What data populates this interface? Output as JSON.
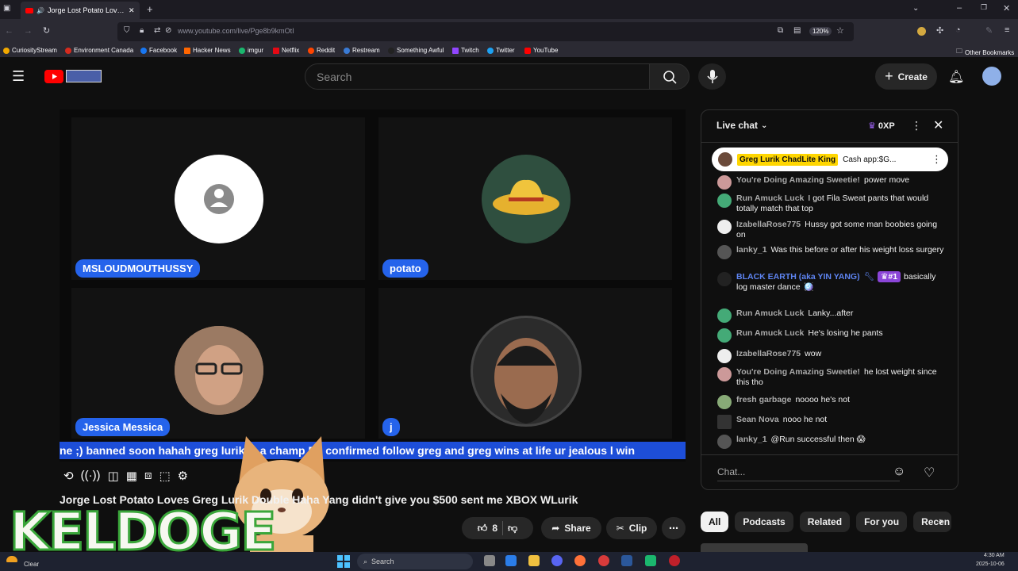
{
  "browser": {
    "tab_title": "Jorge Lost Potato Loves Gr...",
    "url": "www.youtube.com/live/Pge8b9kmOtI",
    "zoom": "120%",
    "bookmarks": [
      "CuriosityStream",
      "Environment Canada",
      "Facebook",
      "Hacker News",
      "imgur",
      "Netflix",
      "Reddit",
      "Restream",
      "Something Awful",
      "Twitch",
      "Twitter",
      "YouTube"
    ],
    "other_bookmarks": "Other Bookmarks"
  },
  "header": {
    "search_placeholder": "Search",
    "create_label": "Create"
  },
  "video": {
    "participants": [
      {
        "name": "MSLOUDMOUTHUSSY"
      },
      {
        "name": "potato"
      },
      {
        "name": "Jessica Messica"
      },
      {
        "name": "j"
      }
    ],
    "ticker": "ne ;) banned soon hahah greg lurik is a champ EZ confirmed follow greg and greg wins at life ur jealous l win",
    "title": "Jorge Lost Potato Loves Greg Lurik Double Haha Yang didn't give you $500 sent me XBOX WLurik",
    "likes": "8",
    "share_label": "Share",
    "clip_label": "Clip"
  },
  "chat": {
    "title": "Live chat",
    "xp": "0XP",
    "pinned_author": "Greg Lurik ChadLite King",
    "pinned_text": "Cash app:$G...",
    "messages": [
      {
        "author": "You're Doing Amazing Sweetie!",
        "text": "power move"
      },
      {
        "author": "Run Amuck Luck",
        "text": "I got Fila Sweat pants that would totally match that top"
      },
      {
        "author": "IzabellaRose775",
        "text": "Hussy got some man boobies going on"
      },
      {
        "author": "lanky_1",
        "text": "Was this before or after his weight loss surgery"
      },
      {
        "author": "BLACK EARTH (aka YIN YANG)",
        "badge": "#1",
        "text": "basically log master dance",
        "mod": true
      },
      {
        "author": "Run Amuck Luck",
        "text": "Lanky...after"
      },
      {
        "author": "Run Amuck Luck",
        "text": "He's losing he pants"
      },
      {
        "author": "IzabellaRose775",
        "text": "wow"
      },
      {
        "author": "You're Doing Amazing Sweetie!",
        "text": "he lost weight since this tho"
      },
      {
        "author": "fresh garbage",
        "text": "noooo he's not"
      },
      {
        "author": "Sean Nova",
        "text": "nooo he not"
      },
      {
        "author": "lanky_1",
        "text": "@Run successful then 😱"
      }
    ],
    "input_placeholder": "Chat..."
  },
  "chips": [
    "All",
    "Podcasts",
    "Related",
    "For you",
    "Recen"
  ],
  "overlay": {
    "channel_text": "KELDOGE"
  },
  "taskbar": {
    "weather": "Clear",
    "search_placeholder": "Search",
    "time": "4:30 AM",
    "date": "2025-10-06"
  }
}
